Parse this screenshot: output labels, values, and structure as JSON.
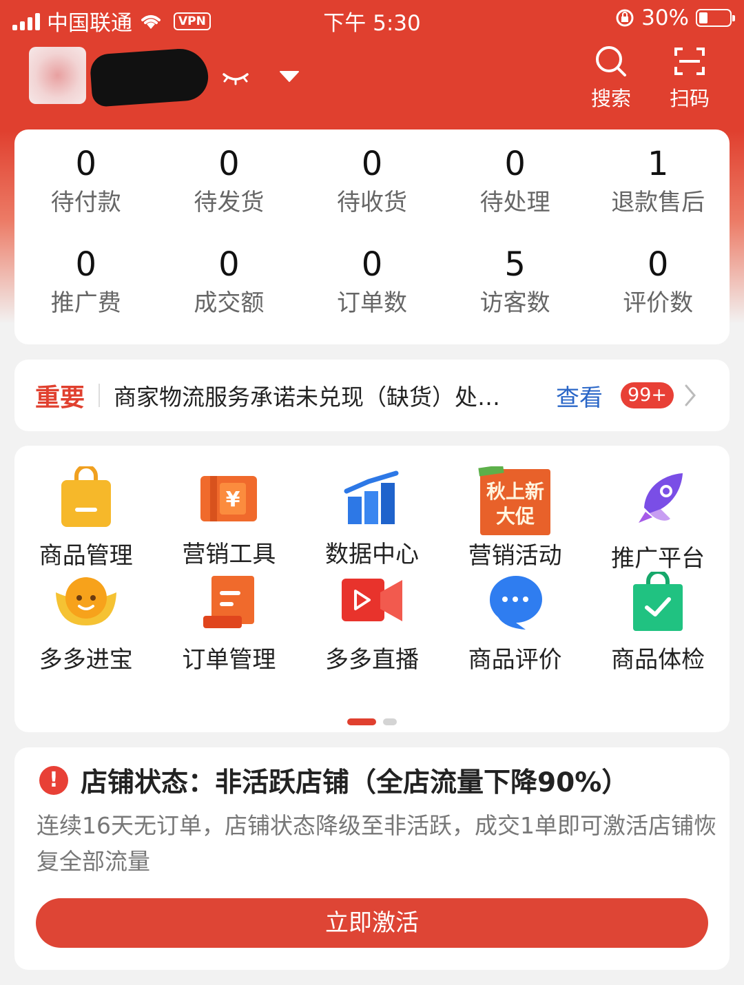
{
  "status_bar": {
    "carrier": "中国联通",
    "vpn": "VPN",
    "time": "下午 5:30",
    "battery": "30%"
  },
  "header": {
    "search_label": "搜索",
    "scan_label": "扫码"
  },
  "stats": [
    {
      "value": "0",
      "label": "待付款"
    },
    {
      "value": "0",
      "label": "待发货"
    },
    {
      "value": "0",
      "label": "待收货"
    },
    {
      "value": "0",
      "label": "待处理"
    },
    {
      "value": "1",
      "label": "退款售后"
    },
    {
      "value": "0",
      "label": "推广费"
    },
    {
      "value": "0",
      "label": "成交额"
    },
    {
      "value": "0",
      "label": "订单数"
    },
    {
      "value": "5",
      "label": "访客数"
    },
    {
      "value": "0",
      "label": "评价数"
    }
  ],
  "notice": {
    "tag": "重要",
    "message": "商家物流服务承诺未兑现（缺货）处…",
    "view_label": "查看",
    "badge": "99+"
  },
  "tools": [
    {
      "label": "商品管理",
      "icon": "shopping-bag-icon"
    },
    {
      "label": "营销工具",
      "icon": "coupon-ticket-icon"
    },
    {
      "label": "数据中心",
      "icon": "bar-chart-icon"
    },
    {
      "label": "营销活动",
      "icon": "autumn-promo-icon",
      "icon_text_1": "秋上新",
      "icon_text_2": "大促"
    },
    {
      "label": "推广平台",
      "icon": "rocket-icon"
    },
    {
      "label": "多多进宝",
      "icon": "ingot-face-icon"
    },
    {
      "label": "订单管理",
      "icon": "scroll-document-icon"
    },
    {
      "label": "多多直播",
      "icon": "video-camera-icon"
    },
    {
      "label": "商品评价",
      "icon": "chat-bubble-icon"
    },
    {
      "label": "商品体检",
      "icon": "check-bag-icon"
    }
  ],
  "store_status": {
    "title": "店铺状态：非活跃店铺（全店流量下降90%）",
    "description": "连续16天无订单，店铺状态降级至非活跃，成交1单即可激活店铺恢复全部流量",
    "button_label": "立即激活"
  },
  "colors": {
    "brand_red": "#e0402f",
    "link_blue": "#2a66c7",
    "badge_red": "#e84036"
  }
}
